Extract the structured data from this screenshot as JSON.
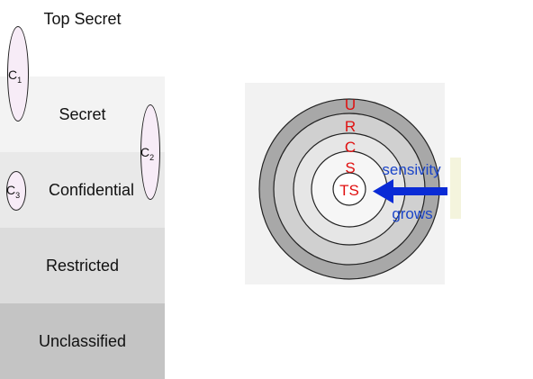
{
  "levels": [
    {
      "label": "Top Secret"
    },
    {
      "label": "Secret"
    },
    {
      "label": "Confidential"
    },
    {
      "label": "Restricted"
    },
    {
      "label": "Unclassified"
    }
  ],
  "compartments": [
    {
      "letter": "C",
      "sub": "1"
    },
    {
      "letter": "C",
      "sub": "2"
    },
    {
      "letter": "C",
      "sub": "3"
    }
  ],
  "rings": {
    "letters": [
      "U",
      "R",
      "C",
      "S"
    ],
    "center": "TS"
  },
  "arrow": {
    "text_top": "sensivity",
    "text_bottom": "grows",
    "color": "#0a2bd6"
  },
  "colors": {
    "ring_text": "#e01010",
    "arrow_text": "#1a44c8"
  }
}
